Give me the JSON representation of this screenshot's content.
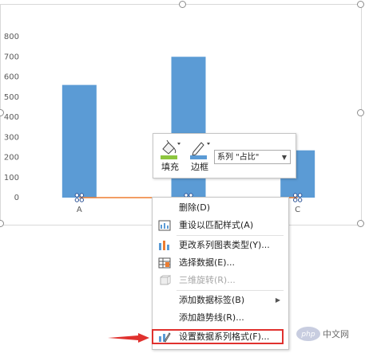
{
  "chart_data": {
    "type": "bar",
    "categories": [
      "A",
      "B",
      "C"
    ],
    "values": [
      560,
      700,
      235
    ],
    "ylim": [
      0,
      800
    ],
    "yticks": [
      0,
      100,
      200,
      300,
      400,
      500,
      600,
      700,
      800
    ],
    "grid": false,
    "bar_color": "#5b9bd5",
    "second_series": {
      "name": "占比",
      "values": [
        0,
        0,
        0
      ],
      "color": "#ed7d31"
    }
  },
  "toolbar": {
    "fill_label": "填充",
    "border_label": "边框",
    "series_select": "系列 \"占比\""
  },
  "menu": {
    "items": [
      {
        "label": "删除(D)",
        "icon": "none",
        "disabled": false
      },
      {
        "label": "重设以匹配样式(A)",
        "icon": "reset-style-icon",
        "disabled": false
      },
      {
        "label": "更改系列图表类型(Y)...",
        "icon": "chart-type-icon",
        "disabled": false
      },
      {
        "label": "选择数据(E)...",
        "icon": "select-data-icon",
        "disabled": false
      },
      {
        "label": "三维旋转(R)...",
        "icon": "rotate-3d-icon",
        "disabled": true
      },
      {
        "label": "添加数据标签(B)",
        "icon": "none",
        "disabled": false
      },
      {
        "label": "添加趋势线(R)...",
        "icon": "none",
        "disabled": false
      },
      {
        "label": "设置数据系列格式(F)...",
        "icon": "format-series-icon",
        "disabled": false
      }
    ]
  },
  "watermark": {
    "text": "php 中文网"
  },
  "colors": {
    "accent": "#e0312e",
    "bar": "#5b9bd5",
    "line": "#ed7d31"
  }
}
